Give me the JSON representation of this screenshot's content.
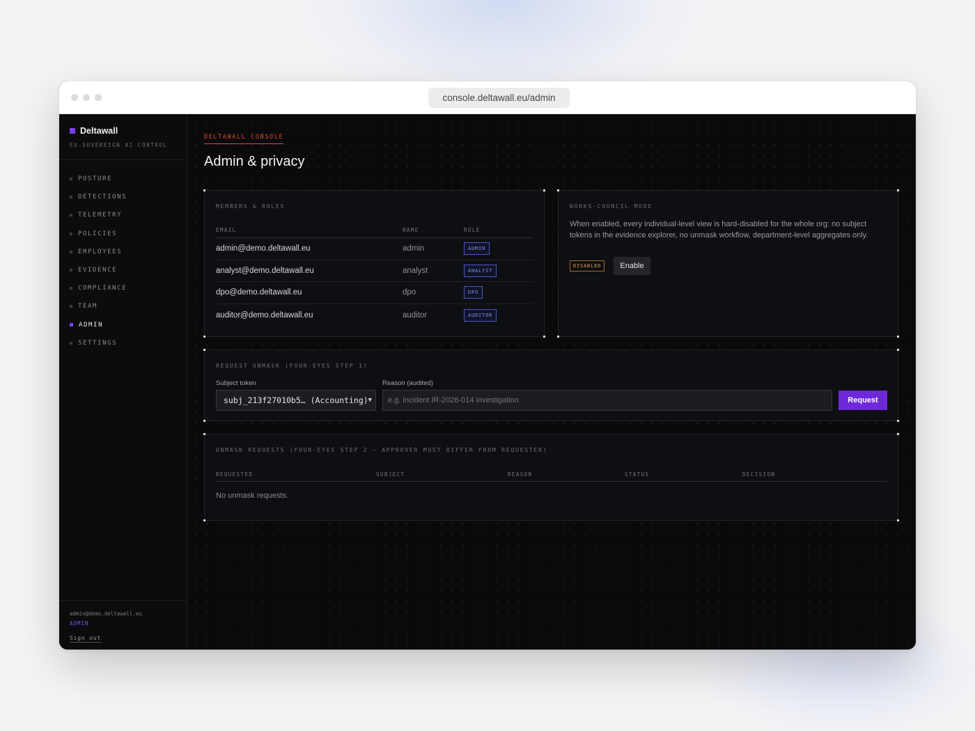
{
  "browser": {
    "url": "console.deltawall.eu/admin"
  },
  "brand": {
    "name": "Deltawall",
    "tagline": "EU-SOVEREIGN AI CONTROL",
    "accent": "#7b3ff2"
  },
  "nav": {
    "items": [
      {
        "label": "POSTURE",
        "active": false
      },
      {
        "label": "DETECTIONS",
        "active": false
      },
      {
        "label": "TELEMETRY",
        "active": false
      },
      {
        "label": "POLICIES",
        "active": false
      },
      {
        "label": "EMPLOYEES",
        "active": false
      },
      {
        "label": "EVIDENCE",
        "active": false
      },
      {
        "label": "COMPLIANCE",
        "active": false
      },
      {
        "label": "TEAM",
        "active": false
      },
      {
        "label": "ADMIN",
        "active": true
      },
      {
        "label": "SETTINGS",
        "active": false
      }
    ]
  },
  "user": {
    "email": "admin@demo.deltawall.eu",
    "role": "ADMIN",
    "signout_label": "Sign out"
  },
  "page": {
    "eyebrow": "DELTAWALL CONSOLE",
    "title": "Admin & privacy"
  },
  "members": {
    "label": "MEMBERS & ROLES",
    "columns": {
      "email": "EMAIL",
      "name": "NAME",
      "role": "ROLE"
    },
    "rows": [
      {
        "email": "admin@demo.deltawall.eu",
        "name": "admin",
        "role": "ADMIN"
      },
      {
        "email": "analyst@demo.deltawall.eu",
        "name": "analyst",
        "role": "ANALYST"
      },
      {
        "email": "dpo@demo.deltawall.eu",
        "name": "dpo",
        "role": "DPO"
      },
      {
        "email": "auditor@demo.deltawall.eu",
        "name": "auditor",
        "role": "AUDITOR"
      }
    ]
  },
  "works_council": {
    "label": "WORKS-COUNCIL MODE",
    "description": "When enabled, every individual-level view is hard-disabled for the whole org: no subject tokens in the evidence explorer, no unmask workflow, department-level aggregates only.",
    "status": "DISABLED",
    "button_label": "Enable"
  },
  "unmask_request": {
    "label": "REQUEST UNMASK (FOUR-EYES STEP 1)",
    "subject_label": "Subject token",
    "subject_value": "subj_213f27010b5… (Accounting)",
    "reason_label": "Reason (audited)",
    "reason_placeholder": "e.g. incident IR-2026-014 investigation",
    "button_label": "Request"
  },
  "unmask_requests": {
    "label": "UNMASK REQUESTS (FOUR-EYES STEP 2 — APPROVER MUST DIFFER FROM REQUESTER)",
    "columns": {
      "requested": "REQUESTED",
      "subject": "SUBJECT",
      "reason": "REASON",
      "status": "STATUS",
      "decision": "DECISION"
    },
    "empty_message": "No unmask requests."
  }
}
